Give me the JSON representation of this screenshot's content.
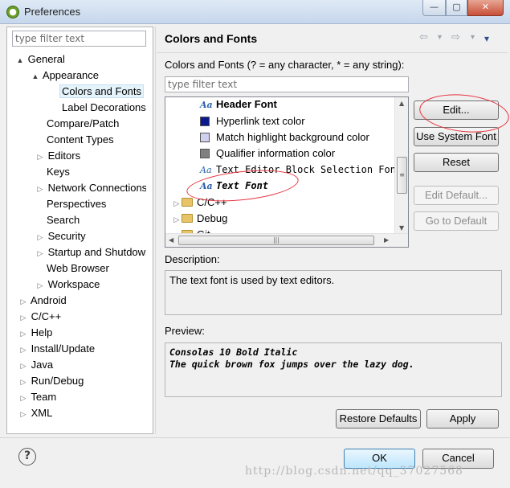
{
  "window": {
    "title": "Preferences",
    "minimize": "—",
    "maximize": "▢",
    "close": "✕"
  },
  "left": {
    "filter_placeholder": "type filter text",
    "tree": [
      {
        "label": "General",
        "toggle": "▲"
      },
      {
        "label": "Appearance",
        "toggle": "▲"
      },
      {
        "label": "Colors and Fonts",
        "toggle": ""
      },
      {
        "label": "Label Decorations",
        "toggle": ""
      },
      {
        "label": "Compare/Patch",
        "toggle": ""
      },
      {
        "label": "Content Types",
        "toggle": ""
      },
      {
        "label": "Editors",
        "toggle": "▷"
      },
      {
        "label": "Keys",
        "toggle": ""
      },
      {
        "label": "Network Connections",
        "toggle": "▷"
      },
      {
        "label": "Perspectives",
        "toggle": ""
      },
      {
        "label": "Search",
        "toggle": ""
      },
      {
        "label": "Security",
        "toggle": "▷"
      },
      {
        "label": "Startup and Shutdown",
        "toggle": "▷"
      },
      {
        "label": "Web Browser",
        "toggle": ""
      },
      {
        "label": "Workspace",
        "toggle": "▷"
      },
      {
        "label": "Android",
        "toggle": "▷"
      },
      {
        "label": "C/C++",
        "toggle": "▷"
      },
      {
        "label": "Help",
        "toggle": "▷"
      },
      {
        "label": "Install/Update",
        "toggle": "▷"
      },
      {
        "label": "Java",
        "toggle": "▷"
      },
      {
        "label": "Run/Debug",
        "toggle": "▷"
      },
      {
        "label": "Team",
        "toggle": "▷"
      },
      {
        "label": "XML",
        "toggle": "▷"
      }
    ]
  },
  "right": {
    "title": "Colors and Fonts",
    "nav": {
      "back": "⇦",
      "back_menu": "▾",
      "forward": "⇨",
      "forward_menu": "▾",
      "view_menu": "▾"
    },
    "hint": "Colors and Fonts (? = any character, * = any string):",
    "filter_placeholder": "type filter text",
    "font_tree": [
      {
        "label": "Header Font",
        "icon": "Aa",
        "swatch": ""
      },
      {
        "label": "Hyperlink text color",
        "icon": "",
        "swatch": "#0a1a8c"
      },
      {
        "label": "Match highlight background color",
        "icon": "",
        "swatch": "#d0d0f0"
      },
      {
        "label": "Qualifier information color",
        "icon": "",
        "swatch": "#808080"
      },
      {
        "label": "Text Editor Block Selection Font",
        "icon": "Aa",
        "swatch": ""
      },
      {
        "label": "Text Font",
        "icon": "Aa",
        "swatch": ""
      },
      {
        "label": "C/C++",
        "icon": "folder",
        "swatch": ""
      },
      {
        "label": "Debug",
        "icon": "folder",
        "swatch": ""
      },
      {
        "label": "Git",
        "icon": "folder",
        "swatch": ""
      }
    ],
    "buttons": {
      "edit": "Edit...",
      "use_system_font": "Use System Font",
      "reset": "Reset",
      "edit_default": "Edit Default...",
      "go_to_default": "Go to Default"
    },
    "description_label": "Description:",
    "description": "The text font is used by text editors.",
    "preview_label": "Preview:",
    "preview_line1": "Consolas 10 Bold Italic",
    "preview_line2": "The quick brown fox jumps over the lazy dog.",
    "restore_defaults": "Restore Defaults",
    "apply": "Apply"
  },
  "footer": {
    "help": "?",
    "ok": "OK",
    "cancel": "Cancel",
    "watermark": "http://blog.csdn.net/qq_37027568"
  },
  "colors": {
    "selection": "#e5f3fb",
    "annotation": "#e8323c",
    "titlebar": "#c6d7ec"
  }
}
